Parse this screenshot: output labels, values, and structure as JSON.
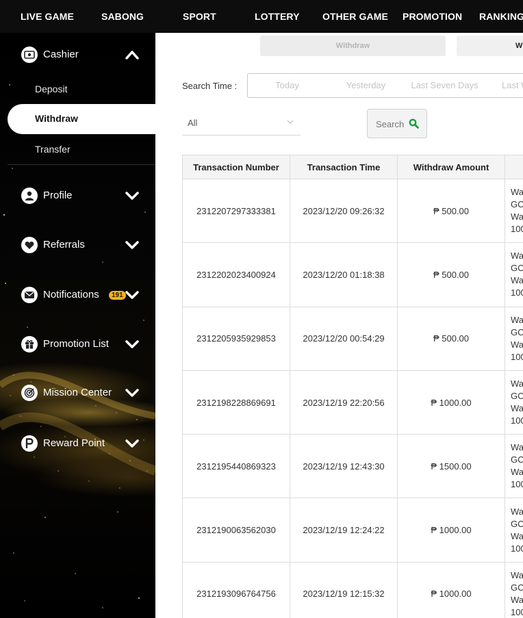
{
  "topnav": {
    "items": [
      "LIVE GAME",
      "SABONG",
      "SPORT",
      "LOTTERY",
      "OTHER GAME",
      "PROMOTION",
      "RANKING"
    ]
  },
  "sidebar": {
    "cashier": {
      "label": "Cashier",
      "icon": "cash-icon",
      "sub_items": [
        "Deposit",
        "Withdraw",
        "Transfer"
      ],
      "active_sub": "Withdraw"
    },
    "items": [
      {
        "label": "Profile",
        "icon": "user-icon"
      },
      {
        "label": "Referrals",
        "icon": "heart-icon"
      },
      {
        "label": "Notifications",
        "icon": "mail-icon",
        "badge": "191"
      },
      {
        "label": "Promotion List",
        "icon": "gift-icon"
      },
      {
        "label": "Mission Center",
        "icon": "target-icon"
      },
      {
        "label": "Reward Point",
        "icon": "reward-p-icon"
      }
    ]
  },
  "tabs": [
    {
      "label": "Withdraw"
    },
    {
      "label": "W"
    }
  ],
  "filter": {
    "search_time_label": "Search Time :",
    "time_options": [
      "Today",
      "Yesterday",
      "Last Seven Days",
      "Last W"
    ],
    "status_select": "All",
    "search_button": "Search"
  },
  "table": {
    "columns": [
      "Transaction Number",
      "Transaction Time",
      "Withdraw Amount"
    ],
    "rows": [
      {
        "number": "2312207297333381",
        "time": "2023/12/20 09:26:32",
        "amount": "₱ 500.00",
        "detail": [
          "Wa",
          "GC",
          "Wa",
          "100"
        ]
      },
      {
        "number": "2312202023400924",
        "time": "2023/12/20 01:18:38",
        "amount": "₱ 500.00",
        "detail": [
          "Wa",
          "GC",
          "Wa",
          "100"
        ]
      },
      {
        "number": "2312205935929853",
        "time": "2023/12/20 00:54:29",
        "amount": "₱ 500.00",
        "detail": [
          "Wa",
          "GC",
          "Wa",
          "100"
        ]
      },
      {
        "number": "2312198228869691",
        "time": "2023/12/19 22:20:56",
        "amount": "₱ 1000.00",
        "detail": [
          "Wa",
          "GC",
          "Wa",
          "100"
        ]
      },
      {
        "number": "2312195440869323",
        "time": "2023/12/19 12:43:30",
        "amount": "₱ 1500.00",
        "detail": [
          "Wa",
          "GC",
          "Wa",
          "100"
        ]
      },
      {
        "number": "2312190063562030",
        "time": "2023/12/19 12:24:22",
        "amount": "₱ 1000.00",
        "detail": [
          "Wa",
          "GC",
          "Wa",
          "100"
        ]
      },
      {
        "number": "2312193096764756",
        "time": "2023/12/19 12:15:32",
        "amount": "₱ 1000.00",
        "detail": [
          "Wa",
          "GC",
          "Wa",
          "100"
        ]
      }
    ]
  },
  "colors": {
    "nav_bg": "#0d0d0d",
    "badge": "#f0b323",
    "accent_search_icon": "#1a9e3f"
  }
}
